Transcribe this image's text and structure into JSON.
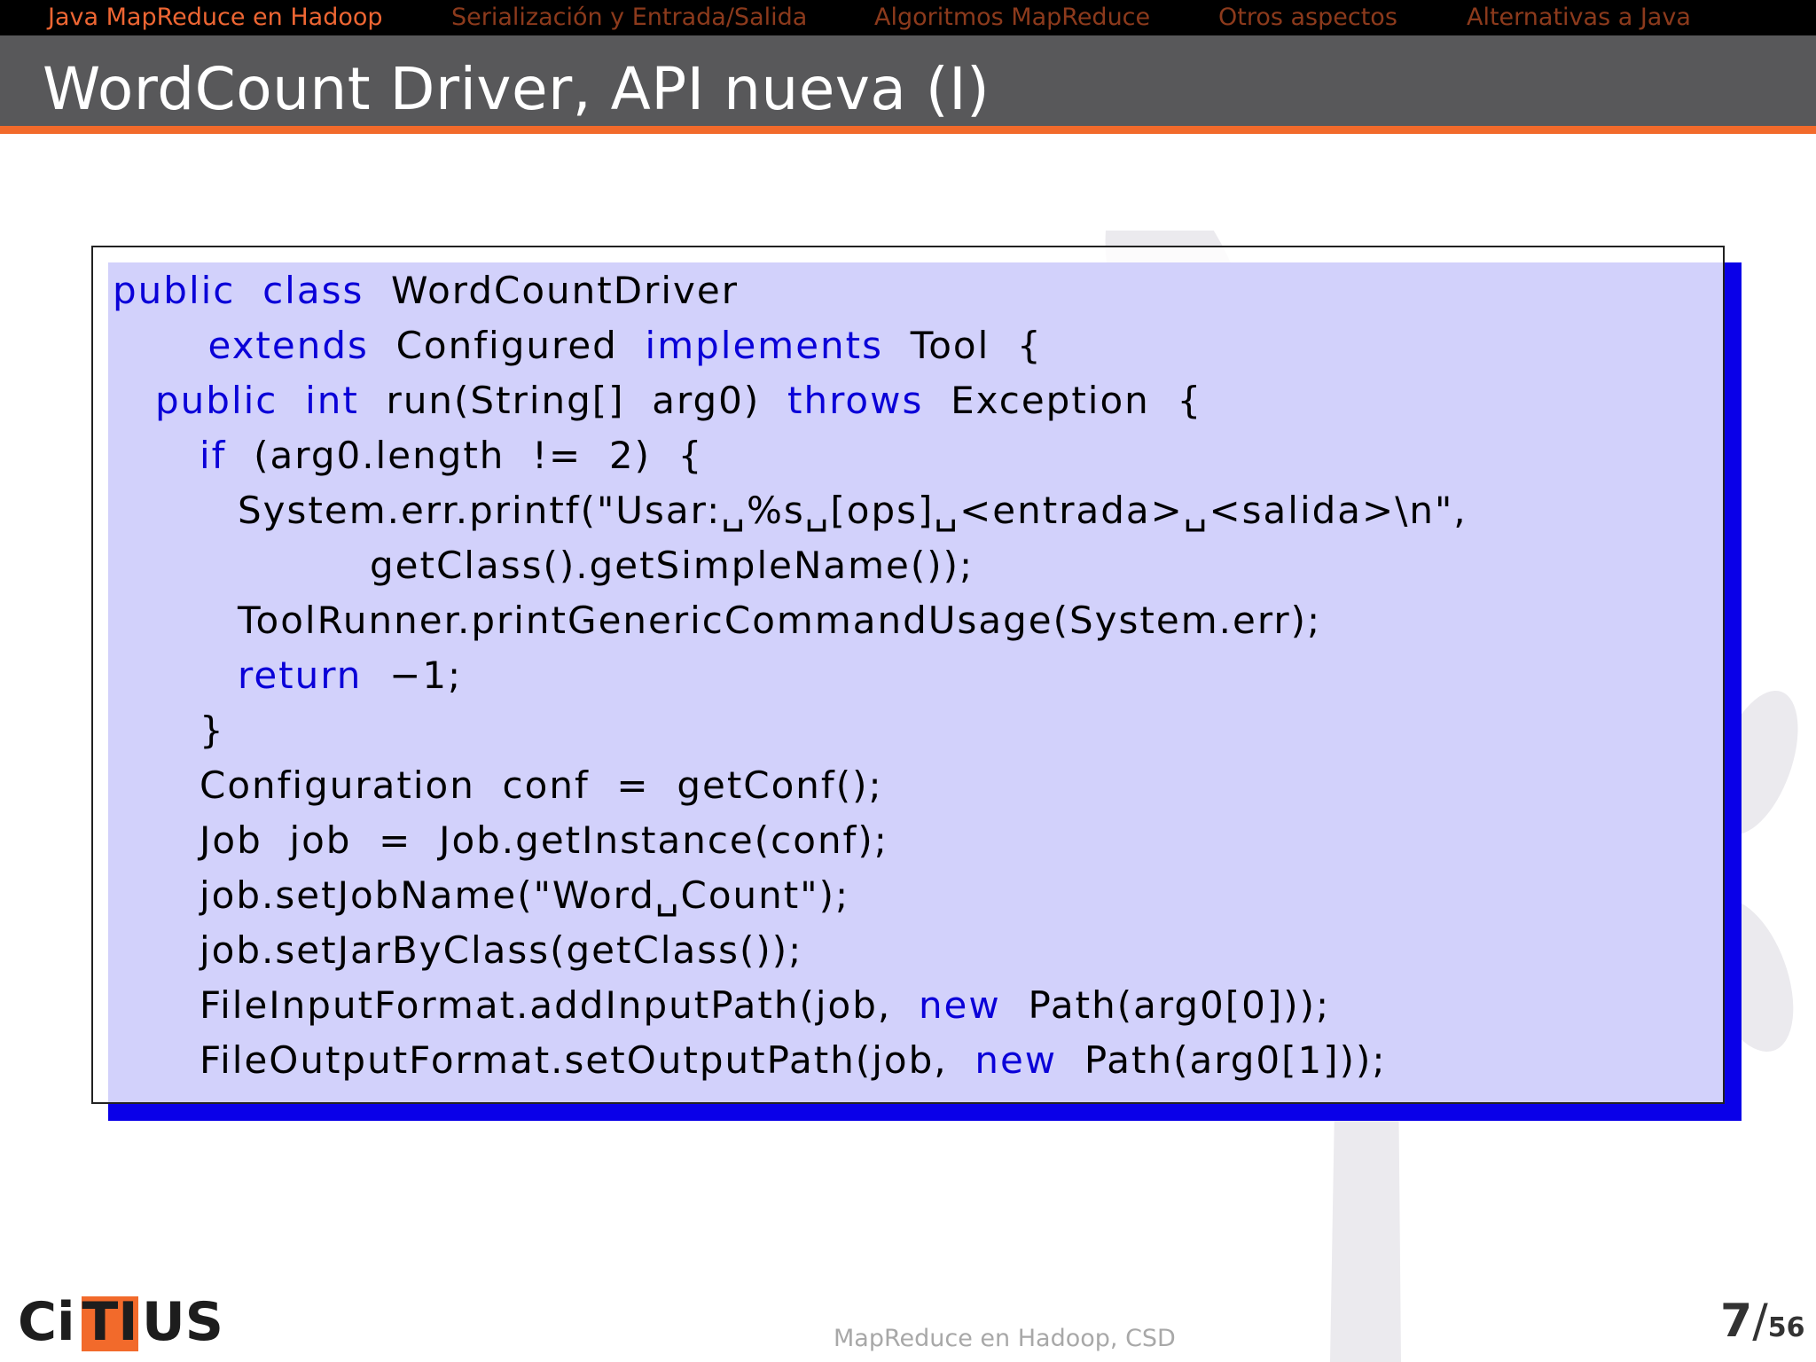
{
  "nav": {
    "items": [
      "Java MapReduce en Hadoop",
      "Serialización y Entrada/Salida",
      "Algoritmos MapReduce",
      "Otros aspectos",
      "Alternativas a Java"
    ],
    "active_index": 0
  },
  "slide": {
    "title": "WordCount Driver, API nueva (I)"
  },
  "code": {
    "lines": [
      [
        {
          "t": "public",
          "k": true
        },
        {
          "t": "  "
        },
        {
          "t": "class",
          "k": true
        },
        {
          "t": "  WordCountDriver"
        }
      ],
      [
        {
          "t": "       "
        },
        {
          "t": "extends",
          "k": true
        },
        {
          "t": "  Configured  "
        },
        {
          "t": "implements",
          "k": true
        },
        {
          "t": "  Tool  {"
        }
      ],
      [
        {
          "t": "public",
          "k": true
        },
        {
          "t": "  "
        },
        {
          "t": "int",
          "k": true
        },
        {
          "t": "  run(String[]  arg0)  "
        },
        {
          "t": "throws",
          "k": true
        },
        {
          "t": "  Exception  {"
        }
      ],
      [
        {
          "t": "if",
          "k": true
        },
        {
          "t": "  (arg0.length  !=  2)  {"
        }
      ],
      [
        {
          "t": "System.err.printf(\"Usar:␣%s␣[ops]␣<entrada>␣<salida>\\n\","
        }
      ],
      [
        {
          "t": "getClass().getSimpleName());"
        }
      ],
      [
        {
          "t": "ToolRunner.printGenericCommandUsage(System.err);"
        }
      ],
      [
        {
          "t": "return",
          "k": true
        },
        {
          "t": "  −1;"
        }
      ],
      [
        {
          "t": "}"
        }
      ],
      [
        {
          "t": "Configuration  conf  =  getConf();"
        }
      ],
      [
        {
          "t": "Job  job  =  Job.getInstance(conf);"
        }
      ],
      [
        {
          "t": "job.setJobName(\"Word␣Count\");"
        }
      ],
      [
        {
          "t": "job.setJarByClass(getClass());"
        }
      ],
      [
        {
          "t": "FileInputFormat.addInputPath(job,  "
        },
        {
          "t": "new",
          "k": true
        },
        {
          "t": "  Path(arg0[0]));"
        }
      ],
      [
        {
          "t": "FileOutputFormat.setOutputPath(job,  "
        },
        {
          "t": "new",
          "k": true
        },
        {
          "t": "  Path(arg0[1]));"
        }
      ]
    ]
  },
  "footer": {
    "logo": "CiTIUS",
    "center_text": "MapReduce en Hadoop, CSD",
    "page_current": "7",
    "page_separator": "/",
    "page_total": "56"
  },
  "colors": {
    "accent_orange": "#f26a2b",
    "keyword_blue": "#0a00d8",
    "shadow_blue": "#0a00e8",
    "title_bar": "#58585a"
  }
}
